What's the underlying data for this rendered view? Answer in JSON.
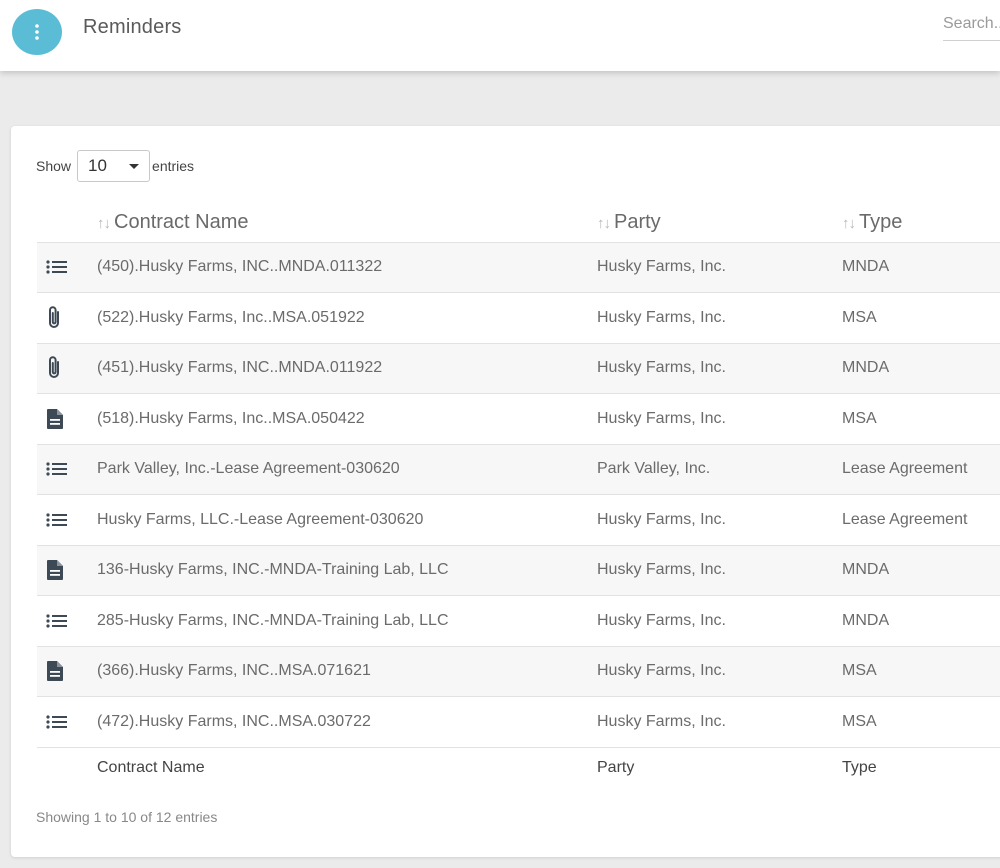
{
  "header": {
    "title": "Reminders",
    "menu_icon": "more-vertical-icon",
    "search_placeholder": "Search..."
  },
  "table": {
    "show_label": "Show",
    "page_length": "10",
    "entries_label": "entries",
    "columns": [
      "Contract Name",
      "Party",
      "Type"
    ],
    "rows": [
      {
        "icon": "list-icon",
        "contract_name": "(450).Husky Farms, INC..MNDA.011322",
        "party": "Husky Farms, Inc.",
        "type": "MNDA"
      },
      {
        "icon": "attachment-icon",
        "contract_name": "(522).Husky Farms, Inc..MSA.051922",
        "party": "Husky Farms, Inc.",
        "type": "MSA"
      },
      {
        "icon": "attachment-icon",
        "contract_name": "(451).Husky Farms, INC..MNDA.011922",
        "party": "Husky Farms, Inc.",
        "type": "MNDA"
      },
      {
        "icon": "document-icon",
        "contract_name": "(518).Husky Farms, Inc..MSA.050422",
        "party": "Husky Farms, Inc.",
        "type": "MSA"
      },
      {
        "icon": "list-icon",
        "contract_name": "Park Valley, Inc.-Lease Agreement-030620",
        "party": "Park Valley, Inc.",
        "type": "Lease Agreement"
      },
      {
        "icon": "list-icon",
        "contract_name": "Husky Farms, LLC.-Lease Agreement-030620",
        "party": "Husky Farms, Inc.",
        "type": "Lease Agreement"
      },
      {
        "icon": "document-icon",
        "contract_name": "136-Husky Farms, INC.-MNDA-Training Lab, LLC",
        "party": "Husky Farms, Inc.",
        "type": "MNDA"
      },
      {
        "icon": "list-icon",
        "contract_name": "285-Husky Farms, INC.-MNDA-Training Lab, LLC",
        "party": "Husky Farms, Inc.",
        "type": "MNDA"
      },
      {
        "icon": "document-icon",
        "contract_name": "(366).Husky Farms, INC..MSA.071621",
        "party": "Husky Farms, Inc.",
        "type": "MSA"
      },
      {
        "icon": "list-icon",
        "contract_name": "(472).Husky Farms, INC..MSA.030722",
        "party": "Husky Farms, Inc.",
        "type": "MSA"
      }
    ],
    "info": "Showing 1 to 10 of 12 entries"
  },
  "colors": {
    "menu_button": "#5bbcd6",
    "icon": "#3d4a55",
    "striped_row": "#f7f7f7"
  }
}
